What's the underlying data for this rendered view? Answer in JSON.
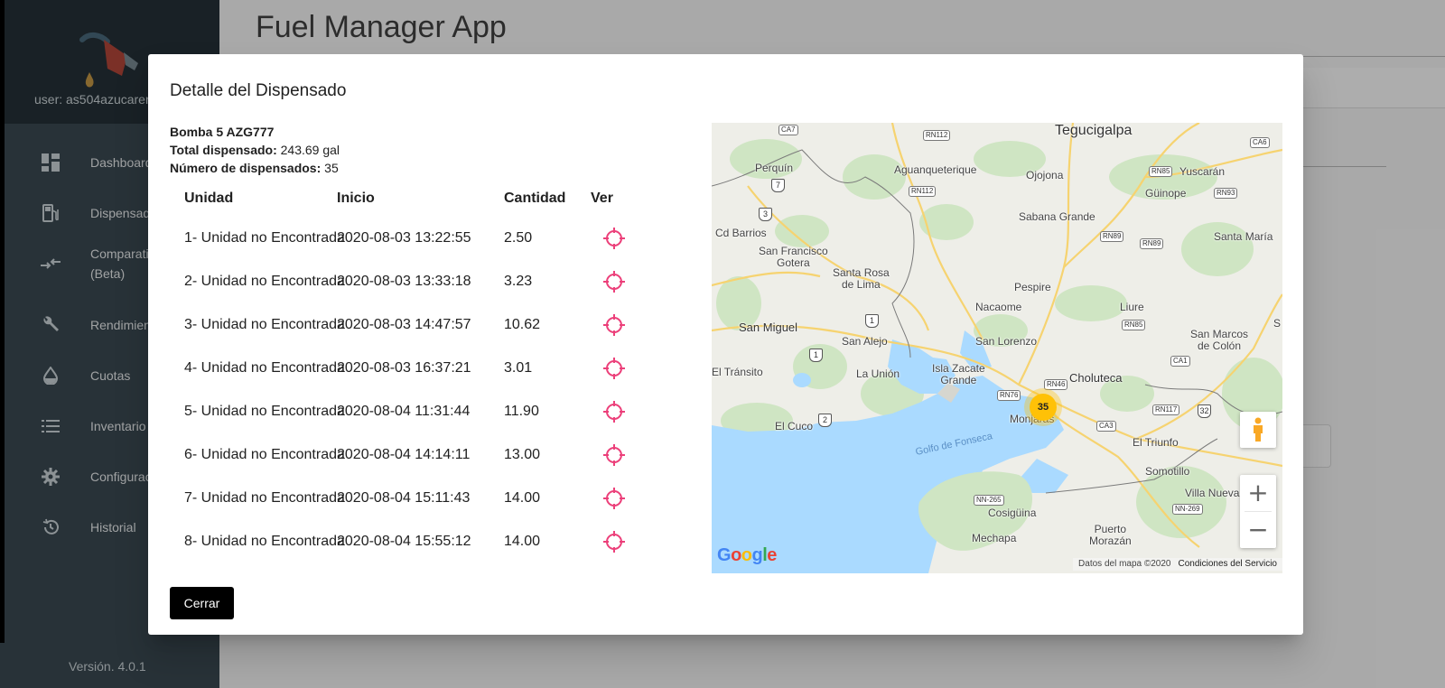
{
  "app": {
    "title": "Fuel Manager App",
    "version": "Versión. 4.0.1"
  },
  "sidebar": {
    "user": "user: as504azucarer",
    "items": [
      {
        "label": "Dashboard",
        "icon": "dashboard-icon"
      },
      {
        "label": "Dispensad",
        "icon": "fuel-pump-icon"
      },
      {
        "label": "Comparati\n(Beta)",
        "icon": "compare-arrows-icon"
      },
      {
        "label": "Rendimien",
        "icon": "wrench-icon"
      },
      {
        "label": "Cuotas",
        "icon": "drop-icon"
      },
      {
        "label": "Inventario",
        "icon": "list-icon"
      },
      {
        "label": "Configurac",
        "icon": "gear-icon"
      },
      {
        "label": "Historial",
        "icon": "history-icon"
      }
    ]
  },
  "modal": {
    "title": "Detalle del Dispensado",
    "pump": "Bomba 5 AZG777",
    "total_label": "Total dispensado:",
    "total_value": "243.69 gal",
    "count_label": "Número de dispensados:",
    "count_value": "35",
    "close_label": "Cerrar",
    "table": {
      "headers": [
        "Unidad",
        "Inicio",
        "Cantidad",
        "Ver"
      ],
      "rows": [
        {
          "unit": "1- Unidad no Encontrada",
          "start": "2020-08-03 13:22:55",
          "qty": "2.50"
        },
        {
          "unit": "2- Unidad no Encontrada",
          "start": "2020-08-03 13:33:18",
          "qty": "3.23"
        },
        {
          "unit": "3- Unidad no Encontrada",
          "start": "2020-08-03 14:47:57",
          "qty": "10.62"
        },
        {
          "unit": "4- Unidad no Encontrada",
          "start": "2020-08-03 16:37:21",
          "qty": "3.01"
        },
        {
          "unit": "5- Unidad no Encontrada",
          "start": "2020-08-04 11:31:44",
          "qty": "11.90"
        },
        {
          "unit": "6- Unidad no Encontrada",
          "start": "2020-08-04 14:14:11",
          "qty": "13.00"
        },
        {
          "unit": "7- Unidad no Encontrada",
          "start": "2020-08-04 15:11:43",
          "qty": "14.00"
        },
        {
          "unit": "8- Unidad no Encontrada",
          "start": "2020-08-04 15:55:12",
          "qty": "14.00"
        }
      ]
    }
  },
  "map": {
    "cluster_count": "35",
    "places": {
      "tegucigalpa": "Tegucigalpa",
      "perquin": "Perquín",
      "aguanqueterique": "Aguanqueterique",
      "ojojona": "Ojojona",
      "yuscaran": "Yuscarán",
      "guinope": "Güinope",
      "cd_barrios": "Cd Barrios",
      "sabana_grande": "Sabana Grande",
      "san_francisco_gotera": "San Francisco\nGotera",
      "santa_rosa_de_lima": "Santa Rosa\nde Lima",
      "santa_maria": "Santa María",
      "pespire": "Pespire",
      "nacaome": "Nacaome",
      "liure": "Liure",
      "san_miguel": "San Miguel",
      "san_alejo": "San Alejo",
      "san_lorenzo": "San Lorenzo",
      "san_marcos_de_colon": "San Marcos\nde Colón",
      "el_transito": "El Tránsito",
      "la_union": "La Unión",
      "isla_zacate_grande": "Isla Zacate\nGrande",
      "choluteca": "Choluteca",
      "monjaras": "Monjarás",
      "el_cuco": "El Cuco",
      "golfo_de_fonseca": "Golfo de Fonseca",
      "el_triunfo": "El Triunfo",
      "somotillo": "Somotillo",
      "villa_nueva": "Villa Nueva",
      "cosiguina": "Cosigüina",
      "puerto_morazan": "Puerto\nMorazán",
      "mechapa": "Mechapa",
      "s_edge": "S"
    },
    "roads": {
      "ca7": "CA7",
      "rn112a": "RN112",
      "ca6": "CA6",
      "rn85a": "RN85",
      "rn112b": "RN112",
      "rn93": "RN93",
      "rn89a": "RN89",
      "rn89b": "RN89",
      "rn85b": "RN85",
      "ca1a": "CA1",
      "rn46": "RN46",
      "rn76": "RN76",
      "ca3": "CA3",
      "rn117": "RN117",
      "nn265": "NN-265",
      "nn269": "NN-269",
      "s7": "7",
      "s3": "3",
      "s1a": "1",
      "s1b": "1",
      "s2": "2",
      "s32": "32"
    },
    "google": "Google",
    "attribution": "Datos del mapa ©2020",
    "terms": "Condiciones del Servicio"
  }
}
